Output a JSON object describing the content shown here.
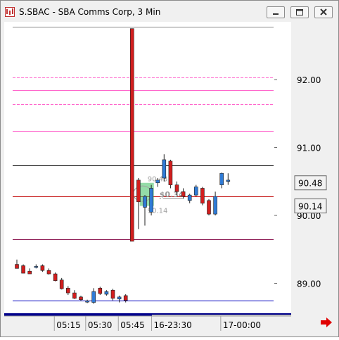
{
  "window": {
    "title": "S.SBAC - SBA Comms Corp, 3 Min",
    "buttons": [
      "minimize",
      "restore",
      "close"
    ],
    "icon": "chart-app-icon",
    "nav_icon": "right-arrow-icon"
  },
  "colors": {
    "up_candle": "#2f7bd6",
    "down_candle": "#d21e1e",
    "pink_level": "#ff66cc",
    "purple_level": "#800040",
    "blue_level": "#0000c0",
    "gray_level": "#888888",
    "box_fill": "#3cc060",
    "nav_arrow": "#e00000"
  },
  "chart_data": {
    "type": "candlestick",
    "y_ticks": [
      "92.00",
      "91.00",
      "90.00",
      "89.00"
    ],
    "ylim": [
      88.55,
      92.85
    ],
    "x_ticks": [
      {
        "label": "05:15",
        "bar": 6.4
      },
      {
        "label": "05:30",
        "bar": 11.3
      },
      {
        "label": "05:45",
        "bar": 16.4
      },
      {
        "label": "16-23:30",
        "bar": 21.6
      },
      {
        "label": "17-00:00",
        "bar": 32.4
      }
    ],
    "candles": [
      {
        "o": 89.28,
        "h": 89.35,
        "l": 89.23,
        "c": 89.22
      },
      {
        "o": 89.26,
        "h": 89.28,
        "l": 89.15,
        "c": 89.15
      },
      {
        "o": 89.18,
        "h": 89.22,
        "l": 89.14,
        "c": 89.14
      },
      {
        "o": 89.24,
        "h": 89.28,
        "l": 89.22,
        "c": 89.25
      },
      {
        "o": 89.26,
        "h": 89.28,
        "l": 89.17,
        "c": 89.19
      },
      {
        "o": 89.19,
        "h": 89.22,
        "l": 89.13,
        "c": 89.14
      },
      {
        "o": 89.14,
        "h": 89.16,
        "l": 89.03,
        "c": 89.04
      },
      {
        "o": 89.05,
        "h": 89.08,
        "l": 88.91,
        "c": 88.92
      },
      {
        "o": 88.93,
        "h": 88.96,
        "l": 88.83,
        "c": 88.86
      },
      {
        "o": 88.86,
        "h": 88.9,
        "l": 88.77,
        "c": 88.78
      },
      {
        "o": 88.8,
        "h": 88.82,
        "l": 88.74,
        "c": 88.76
      },
      {
        "o": 88.73,
        "h": 88.76,
        "l": 88.71,
        "c": 88.74
      },
      {
        "o": 88.72,
        "h": 88.93,
        "l": 88.7,
        "c": 88.88
      },
      {
        "o": 88.93,
        "h": 88.95,
        "l": 88.83,
        "c": 88.85
      },
      {
        "o": 88.84,
        "h": 88.9,
        "l": 88.82,
        "c": 88.88
      },
      {
        "o": 88.9,
        "h": 88.92,
        "l": 88.75,
        "c": 88.78
      },
      {
        "o": 88.77,
        "h": 88.82,
        "l": 88.72,
        "c": 88.8
      },
      {
        "o": 88.82,
        "h": 88.84,
        "l": 88.72,
        "c": 88.75
      },
      {
        "o": 92.75,
        "h": 92.75,
        "l": 89.62,
        "c": 89.62
      },
      {
        "o": 90.52,
        "h": 90.55,
        "l": 89.8,
        "c": 90.2
      },
      {
        "o": 90.12,
        "h": 90.3,
        "l": 89.85,
        "c": 90.28
      },
      {
        "o": 90.05,
        "h": 90.45,
        "l": 90.0,
        "c": 90.4
      },
      {
        "o": 90.48,
        "h": 90.55,
        "l": 90.42,
        "c": 90.52
      },
      {
        "o": 90.55,
        "h": 90.9,
        "l": 90.5,
        "c": 90.82
      },
      {
        "o": 90.8,
        "h": 90.82,
        "l": 90.4,
        "c": 90.45
      },
      {
        "o": 90.45,
        "h": 90.5,
        "l": 90.3,
        "c": 90.35
      },
      {
        "o": 90.35,
        "h": 90.4,
        "l": 90.25,
        "c": 90.28
      },
      {
        "o": 90.22,
        "h": 90.32,
        "l": 90.18,
        "c": 90.3
      },
      {
        "o": 90.3,
        "h": 90.45,
        "l": 90.28,
        "c": 90.42
      },
      {
        "o": 90.4,
        "h": 90.42,
        "l": 90.15,
        "c": 90.18
      },
      {
        "o": 90.22,
        "h": 90.24,
        "l": 90.0,
        "c": 90.02
      },
      {
        "o": 90.02,
        "h": 90.35,
        "l": 90.0,
        "c": 90.28
      },
      {
        "o": 90.45,
        "h": 90.63,
        "l": 90.4,
        "c": 90.62
      },
      {
        "o": 90.5,
        "h": 90.62,
        "l": 90.45,
        "c": 90.52
      }
    ],
    "levels": [
      {
        "price": 92.78,
        "color": "#888888"
      },
      {
        "price": 92.03,
        "color": "#ff66cc",
        "dashed": true
      },
      {
        "price": 91.84,
        "color": "#ff66cc"
      },
      {
        "price": 91.64,
        "color": "#ff66cc",
        "dashed": true
      },
      {
        "price": 91.24,
        "color": "#ff66cc"
      },
      {
        "price": 90.74,
        "color": "#000000"
      },
      {
        "price": 90.28,
        "color": "#c00000"
      },
      {
        "price": 89.65,
        "color": "#800040"
      },
      {
        "price": 88.75,
        "color": "#0000c0"
      }
    ],
    "price_labels": [
      "90.48",
      "90.14"
    ],
    "price_label_values": [
      90.48,
      90.14
    ],
    "annotation": {
      "top_label": "90.48",
      "mid_label": "$0.34",
      "bottom_label": "90.14",
      "top_price": 90.48,
      "bottom_price": 90.14,
      "start_bar": 19.2,
      "end_bar": 21.4
    }
  }
}
